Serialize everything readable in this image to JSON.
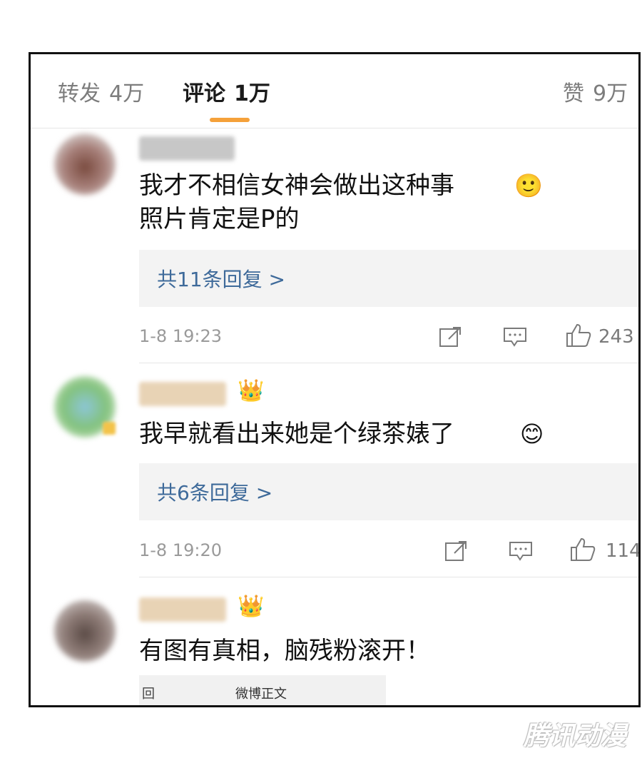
{
  "tabs": {
    "repost": {
      "label": "转发",
      "count": "4万"
    },
    "comment": {
      "label": "评论",
      "count": "1万"
    },
    "like": {
      "label": "赞",
      "count": "9万"
    }
  },
  "colors": {
    "accent": "#f5a13a",
    "link": "#3e6a9a"
  },
  "comments": [
    {
      "text": "我才不相信女神会做出这种事\n照片肯定是P的",
      "emoji": "🙂",
      "replies": "共11条回复 >",
      "time": "1-8 19:23",
      "likes": "243"
    },
    {
      "text": "我早就看出来她是个绿茶婊了",
      "emoji": "😊",
      "replies": "共6条回复 >",
      "time": "1-8 19:20",
      "likes": "114"
    },
    {
      "text": "有图有真相，脑残粉滚开！"
    }
  ],
  "footer": {
    "icon": "回",
    "label": "微博正文"
  },
  "watermark": "腾讯动漫",
  "icons": {
    "vip": "👑",
    "share": "share-icon",
    "comment": "comment-icon",
    "like": "thumbs-up-icon"
  }
}
